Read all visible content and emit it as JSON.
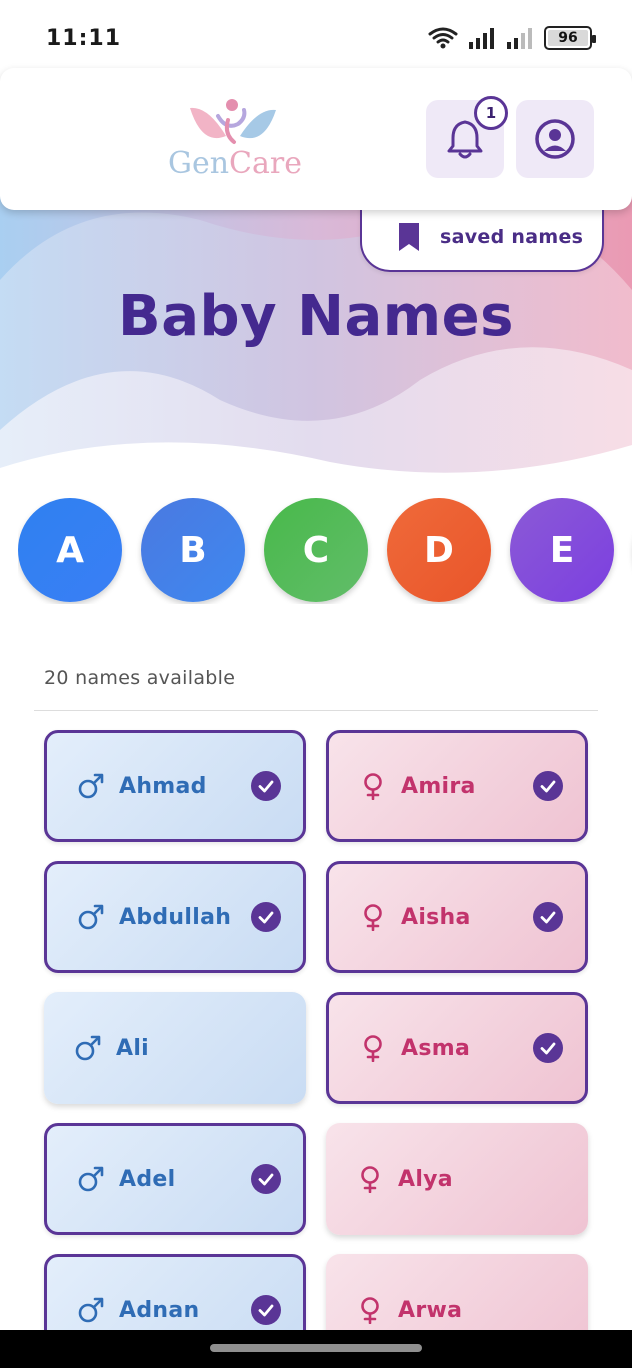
{
  "status_bar": {
    "time": "11:11",
    "battery": "96"
  },
  "header": {
    "logo_part1": "Gen",
    "logo_part2": "Care",
    "notifications_icon": "bell-icon",
    "notifications_badge": "1",
    "profile_icon": "user-circle-icon"
  },
  "saved": {
    "icon": "bookmark-icon",
    "label": "saved names"
  },
  "page": {
    "title": "Baby Names",
    "count_text": "20 names available"
  },
  "letters": [
    {
      "label": "A",
      "color_from": "#2f80f0",
      "color_to": "#3a7ff5"
    },
    {
      "label": "B",
      "color_from": "#4a79e0",
      "color_to": "#3f88f0"
    },
    {
      "label": "C",
      "color_from": "#48b94a",
      "color_to": "#62bd6a"
    },
    {
      "label": "D",
      "color_from": "#ef6a3a",
      "color_to": "#e9552a"
    },
    {
      "label": "E",
      "color_from": "#8b5ad6",
      "color_to": "#7c3fe0"
    }
  ],
  "colors": {
    "accent": "#5a3596",
    "title": "#44298f",
    "boy": "#2f6cb5",
    "girl": "#c2336c"
  },
  "names": [
    {
      "name": "Ahmad",
      "gender": "male",
      "selected": true
    },
    {
      "name": "Amira",
      "gender": "female",
      "selected": true
    },
    {
      "name": "Abdullah",
      "gender": "male",
      "selected": true
    },
    {
      "name": "Aisha",
      "gender": "female",
      "selected": true
    },
    {
      "name": "Ali",
      "gender": "male",
      "selected": false
    },
    {
      "name": "Asma",
      "gender": "female",
      "selected": true
    },
    {
      "name": "Adel",
      "gender": "male",
      "selected": true
    },
    {
      "name": "Alya",
      "gender": "female",
      "selected": false
    },
    {
      "name": "Adnan",
      "gender": "male",
      "selected": true
    },
    {
      "name": "Arwa",
      "gender": "female",
      "selected": false
    }
  ]
}
